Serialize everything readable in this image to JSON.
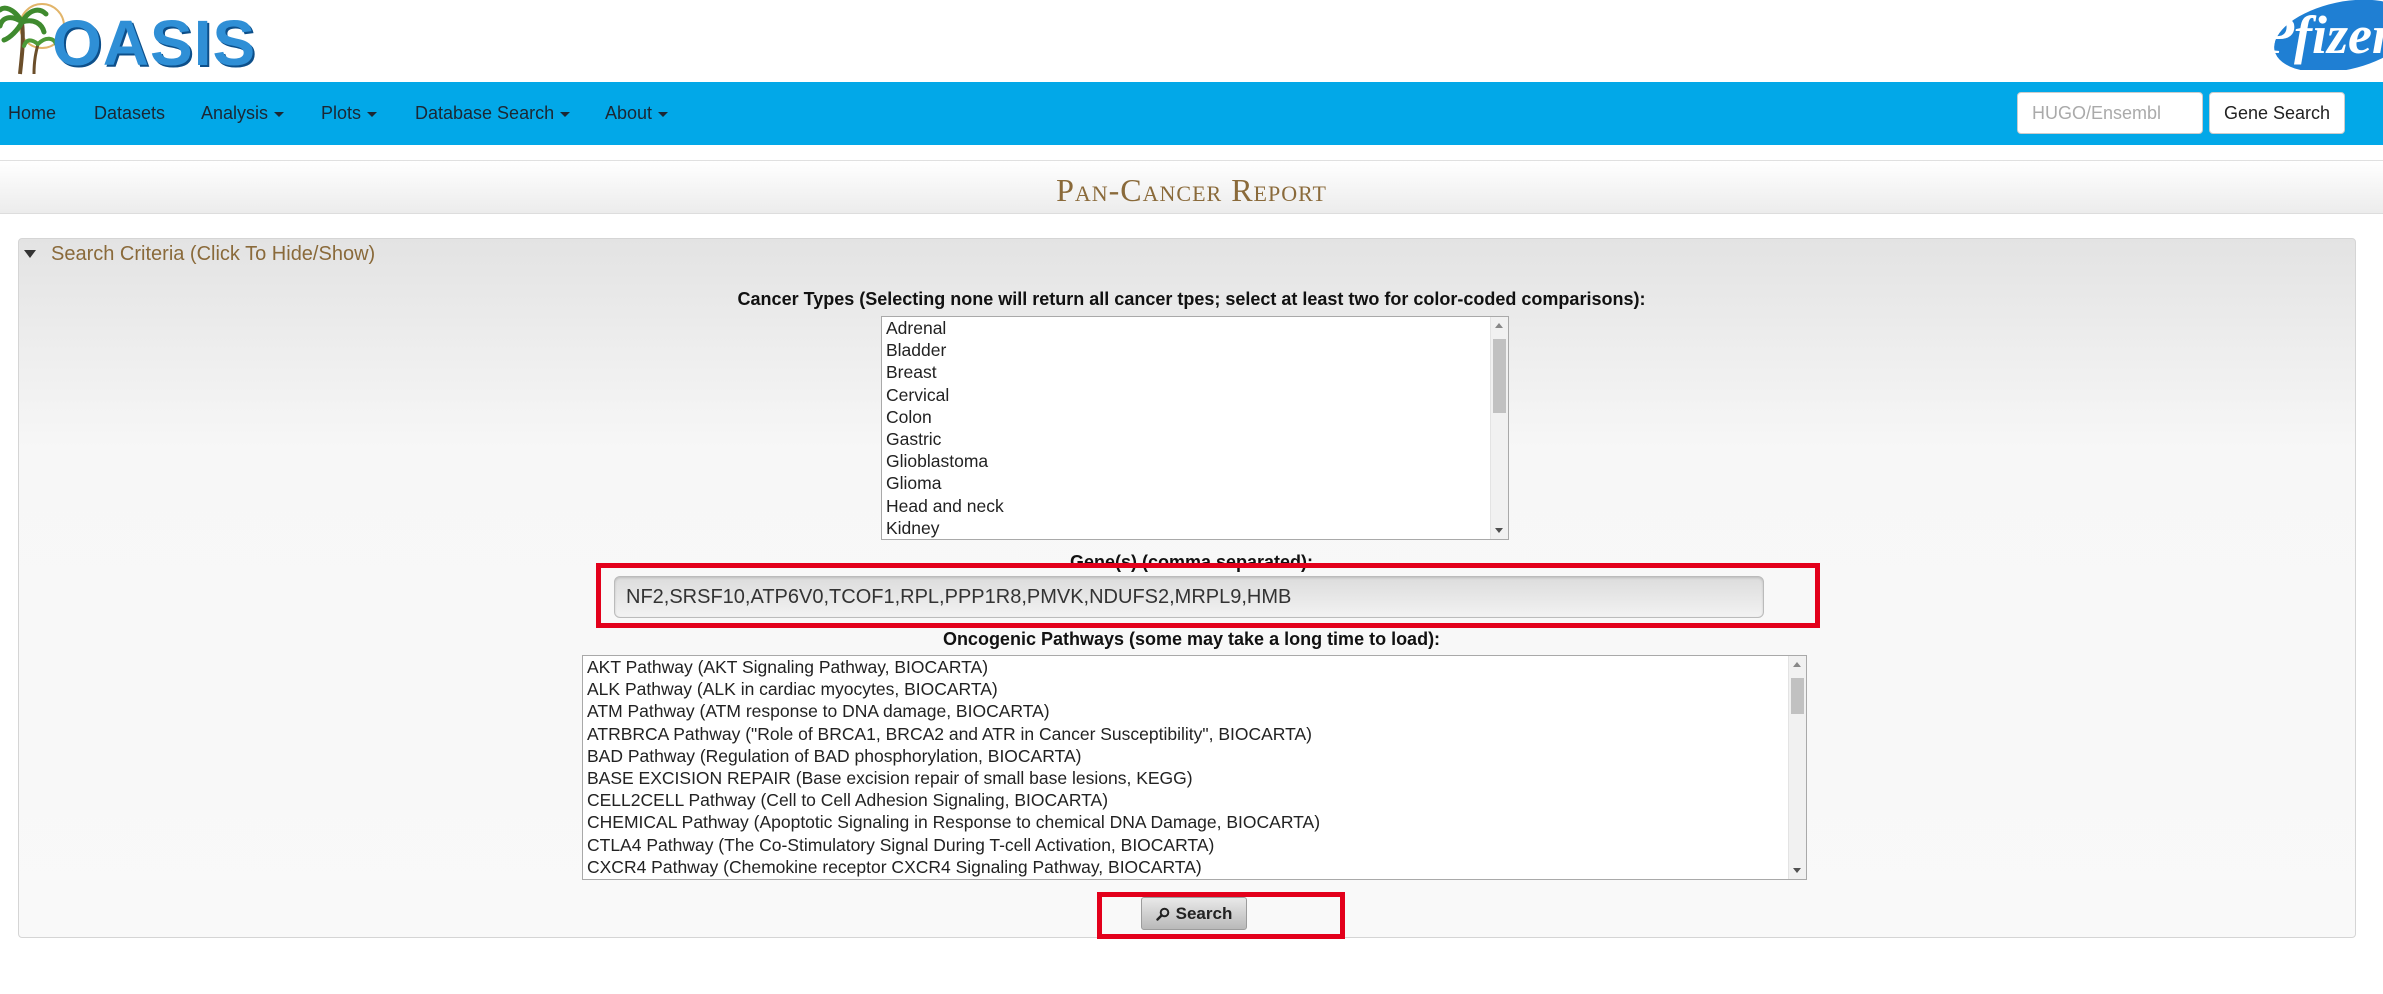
{
  "header": {
    "logo_text": "OASIS",
    "partner_logo_text": "Pfizer"
  },
  "navbar": {
    "items": [
      {
        "label": "Home",
        "dropdown": false
      },
      {
        "label": "Datasets",
        "dropdown": false
      },
      {
        "label": "Analysis",
        "dropdown": true
      },
      {
        "label": "Plots",
        "dropdown": true
      },
      {
        "label": "Database Search",
        "dropdown": true
      },
      {
        "label": "About",
        "dropdown": true
      }
    ],
    "search_placeholder": "HUGO/Ensembl",
    "search_button": "Gene Search",
    "color": "#02a8e8"
  },
  "page": {
    "title": "Pan-Cancer Report"
  },
  "criteria": {
    "toggle_label": "Search Criteria (Click To Hide/Show)",
    "cancer_types_label": "Cancer Types (Selecting none will return all cancer tpes; select at least two for color-coded comparisons):",
    "cancer_types": [
      "Adrenal",
      "Bladder",
      "Breast",
      "Cervical",
      "Colon",
      "Gastric",
      "Glioblastoma",
      "Glioma",
      "Head and neck",
      "Kidney"
    ],
    "genes_label": "Gene(s) (comma separated):",
    "genes_value": "NF2,SRSF10,ATP6V0,TCOF1,RPL,PPP1R8,PMVK,NDUFS2,MRPL9,HMB",
    "pathways_label": "Oncogenic Pathways (some may take a long time to load):",
    "pathways": [
      "AKT Pathway (AKT Signaling Pathway, BIOCARTA)",
      "ALK Pathway (ALK in cardiac myocytes, BIOCARTA)",
      "ATM Pathway (ATM response to DNA damage, BIOCARTA)",
      "ATRBRCA Pathway (\"Role of BRCA1, BRCA2 and ATR in Cancer Susceptibility\", BIOCARTA)",
      "BAD Pathway (Regulation of BAD phosphorylation, BIOCARTA)",
      "BASE EXCISION REPAIR (Base excision repair of small base lesions, KEGG)",
      "CELL2CELL Pathway (Cell to Cell Adhesion Signaling, BIOCARTA)",
      "CHEMICAL Pathway (Apoptotic Signaling in Response to chemical DNA Damage, BIOCARTA)",
      "CTLA4 Pathway (The Co-Stimulatory Signal During T-cell Activation, BIOCARTA)",
      "CXCR4 Pathway (Chemokine receptor CXCR4 Signaling Pathway, BIOCARTA)"
    ],
    "search_button": "Search"
  },
  "colors": {
    "title": "#8a6a3a",
    "highlight": "#e3001b"
  }
}
